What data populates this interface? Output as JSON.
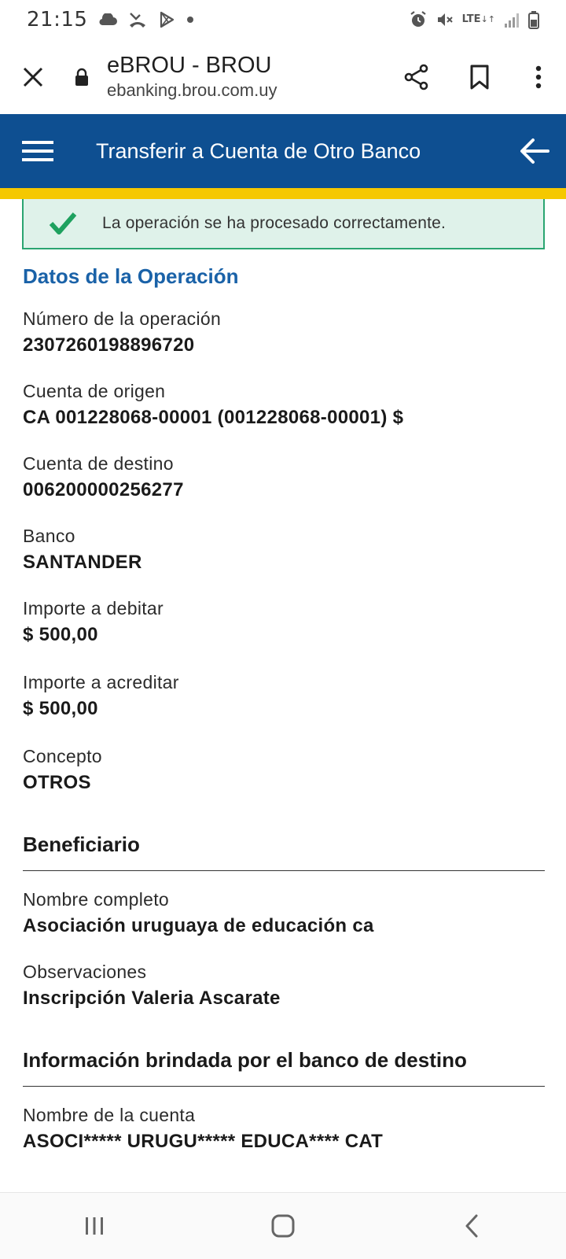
{
  "status_bar": {
    "time": "21:15",
    "network": "LTE",
    "icons": [
      "cloud-icon",
      "missed-call-icon",
      "play-store-icon",
      "dot-icon",
      "alarm-icon",
      "mute-icon",
      "signal-icon",
      "battery-icon"
    ]
  },
  "browser": {
    "page_title": "eBROU - BROU",
    "url": "ebanking.brou.com.uy",
    "icons": [
      "close-icon",
      "lock-icon",
      "share-icon",
      "bookmark-icon",
      "more-vert-icon"
    ]
  },
  "header": {
    "title": "Transferir a Cuenta de Otro Banco",
    "colors": {
      "header_bg": "#0e4f91",
      "accent": "#f5c800"
    }
  },
  "success": {
    "message": "La operación se ha procesado correctamente."
  },
  "operation": {
    "section_title": "Datos de la Operación",
    "fields": [
      {
        "label": "Número de la operación",
        "value": "2307260198896720"
      },
      {
        "label": "Cuenta de origen",
        "value": "CA 001228068-00001 (001228068-00001) $"
      },
      {
        "label": "Cuenta de destino",
        "value": "006200000256277"
      },
      {
        "label": "Banco",
        "value": "SANTANDER"
      },
      {
        "label": "Importe a debitar",
        "value": "$ 500,00"
      },
      {
        "label": "Importe a acreditar",
        "value": "$ 500,00"
      },
      {
        "label": "Concepto",
        "value": "OTROS"
      }
    ]
  },
  "beneficiary": {
    "title": "Beneficiario",
    "fields": [
      {
        "label": "Nombre completo",
        "value": "Asociación uruguaya de educación ca"
      },
      {
        "label": "Observaciones",
        "value": "Inscripción Valeria Ascarate"
      }
    ]
  },
  "destination_bank": {
    "title": "Información brindada por el banco de destino",
    "fields": [
      {
        "label": "Nombre de la cuenta",
        "value": "ASOCI***** URUGU***** EDUCA**** CAT"
      }
    ]
  },
  "navbar": {
    "icons": [
      "recent-apps-icon",
      "home-icon",
      "back-nav-icon"
    ]
  }
}
